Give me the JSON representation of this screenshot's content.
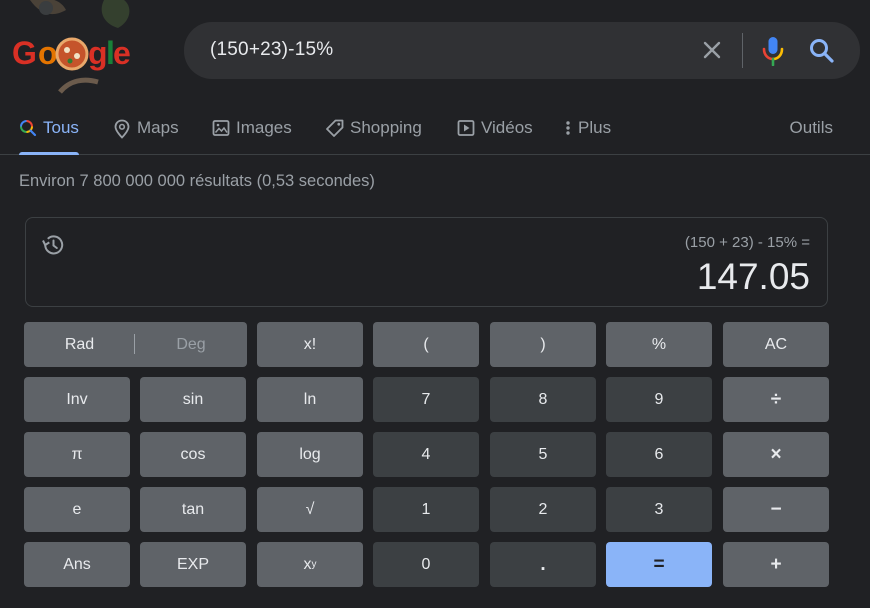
{
  "search": {
    "query": "(150+23)-15%"
  },
  "tabs": [
    {
      "label": "Tous",
      "icon": "search-icon",
      "active": true
    },
    {
      "label": "Maps",
      "icon": "map-pin-icon"
    },
    {
      "label": "Images",
      "icon": "image-icon"
    },
    {
      "label": "Shopping",
      "icon": "tag-icon"
    },
    {
      "label": "Vidéos",
      "icon": "play-icon"
    },
    {
      "label": "Plus",
      "icon": "more-vert-icon"
    }
  ],
  "tools_label": "Outils",
  "stats": "Environ 7 800 000 000 résultats (0,53 secondes)",
  "calculator": {
    "expression": "(150 + 23) - 15% =",
    "result": "147.05",
    "rad_label": "Rad",
    "deg_label": "Deg",
    "keys": {
      "fact": "x!",
      "lparen": "(",
      "rparen": ")",
      "percent": "%",
      "ac": "AC",
      "inv": "Inv",
      "sin": "sin",
      "ln": "ln",
      "seven": "7",
      "eight": "8",
      "nine": "9",
      "divide": "÷",
      "pi": "π",
      "cos": "cos",
      "log": "log",
      "four": "4",
      "five": "5",
      "six": "6",
      "multiply": "×",
      "e": "e",
      "tan": "tan",
      "sqrt": "√",
      "one": "1",
      "two": "2",
      "three": "3",
      "minus": "−",
      "ans": "Ans",
      "exp": "EXP",
      "zero": "0",
      "dot": ".",
      "equals": "=",
      "plus": "+"
    },
    "power_base": "x",
    "power_exp": "y"
  },
  "colors": {
    "background": "#202124",
    "accent": "#8ab4f8",
    "function_key": "#5f6368",
    "number_key": "#3c4043"
  }
}
